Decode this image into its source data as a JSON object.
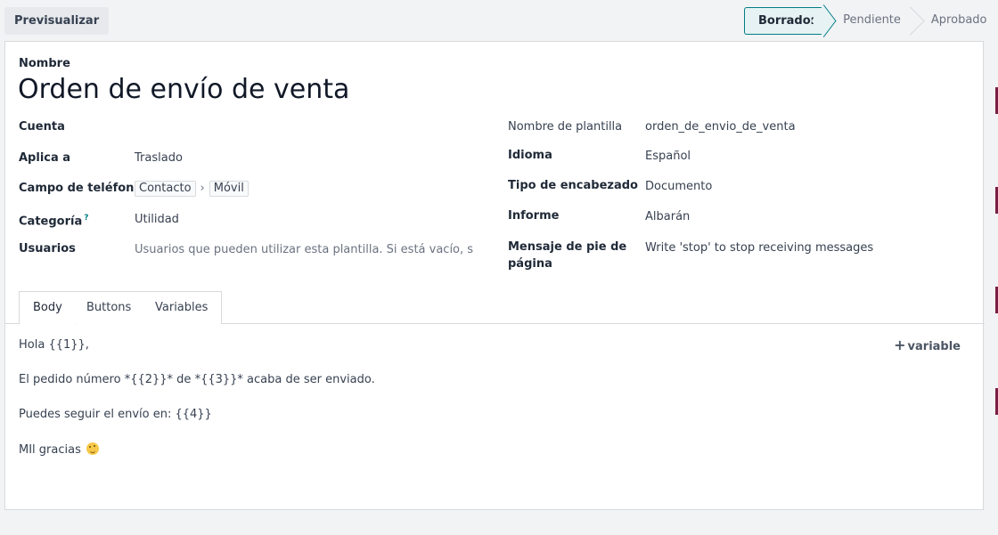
{
  "toolbar": {
    "preview_label": "Previsualizar"
  },
  "status": {
    "stages": [
      "Borrador",
      "Pendiente",
      "Aprobado"
    ],
    "active": "Borrador"
  },
  "form": {
    "name_label": "Nombre",
    "name_value": "Orden de envío de venta",
    "left": {
      "cuenta_label": "Cuenta",
      "cuenta_value": "",
      "aplica_label": "Aplica a",
      "aplica_value": "Traslado",
      "telefono_label": "Campo de teléfono",
      "telefono_path": [
        "Contacto",
        "Móvil"
      ],
      "categoria_label": "Categoría",
      "categoria_help": "?",
      "categoria_value": "Utilidad",
      "usuarios_label": "Usuarios",
      "usuarios_placeholder": "Usuarios que pueden utilizar esta plantilla. Si está vacío, se considera pública"
    },
    "right": {
      "plantilla_label": "Nombre de plantilla",
      "plantilla_value": "orden_de_envio_de_venta",
      "idioma_label": "Idioma",
      "idioma_value": "Español",
      "encabezado_label": "Tipo de encabezado",
      "encabezado_value": "Documento",
      "informe_label": "Informe",
      "informe_value": "Albarán",
      "pie_label_1": "Mensaje de pie de",
      "pie_label_2": "página",
      "pie_value": "Write 'stop' to stop receiving messages"
    }
  },
  "tabs": [
    "Body",
    "Buttons",
    "Variables"
  ],
  "body": {
    "add_variable": "variable",
    "lines": [
      "Hola {{1}},",
      "El pedido número *{{2}}* de  *{{3}}*  acaba de ser enviado.",
      "Puedes seguir el envío en: {{4}}",
      "MIl gracias"
    ]
  },
  "colors": {
    "accent": "#017e84",
    "edge_marker": "#7a1f44"
  }
}
